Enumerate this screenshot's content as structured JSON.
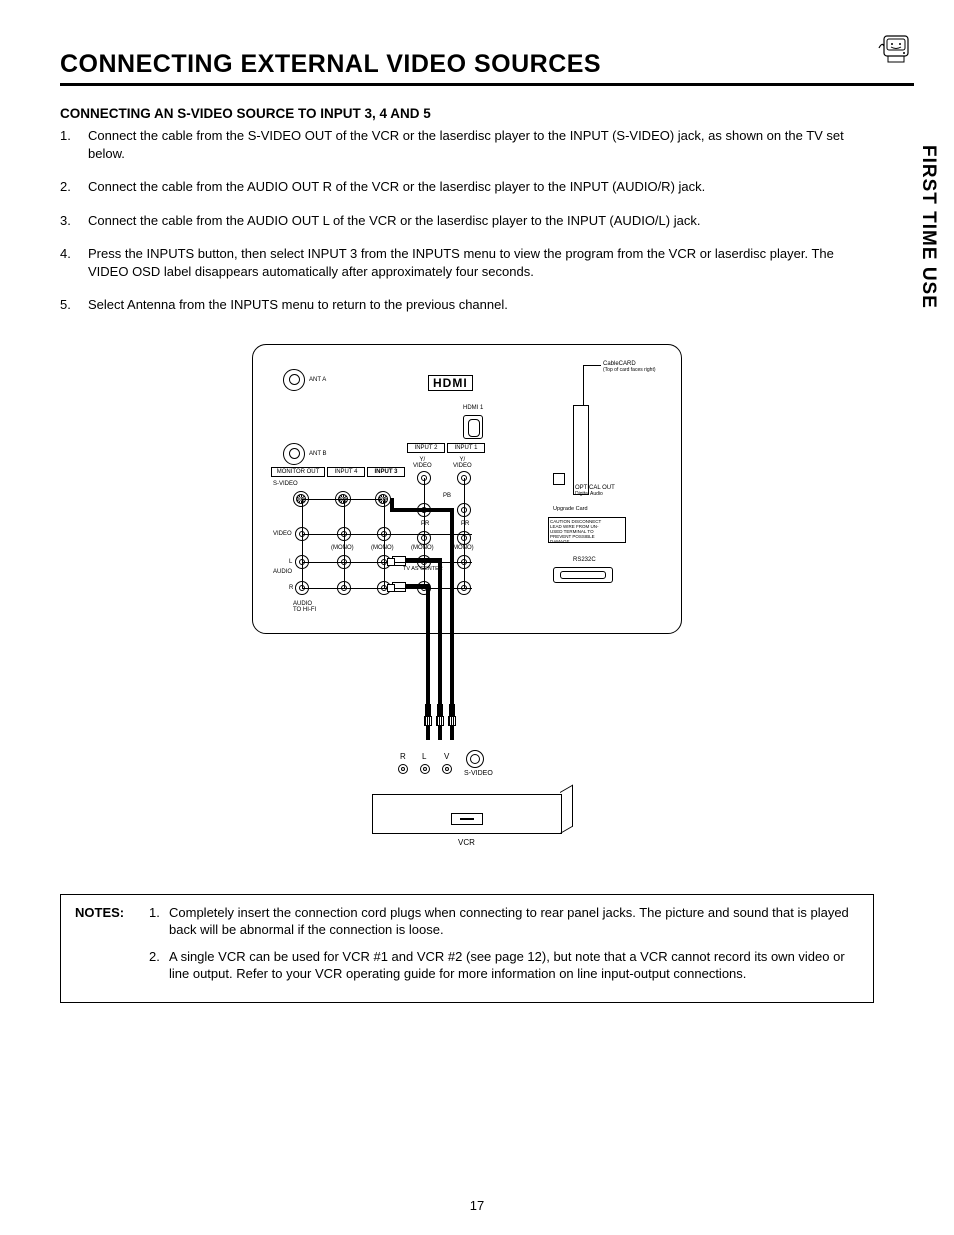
{
  "title": "CONNECTING EXTERNAL VIDEO SOURCES",
  "side_tab": "FIRST TIME USE",
  "section_heading": "CONNECTING AN S-VIDEO SOURCE TO INPUT 3, 4 AND 5",
  "steps": [
    "Connect the cable from the S-VIDEO OUT of the VCR or the laserdisc player to the INPUT (S-VIDEO) jack, as shown on the TV set below.",
    "Connect the cable from the AUDIO OUT R of the VCR or the laserdisc player to the INPUT (AUDIO/R) jack.",
    "Connect the cable from the AUDIO OUT L of the VCR or the laserdisc player to the INPUT (AUDIO/L) jack.",
    "Press the INPUTS button, then select INPUT 3 from the INPUTS menu to view the program from the VCR or laserdisc player. The VIDEO OSD label disappears automatically after approximately four seconds.",
    "Select Antenna from the INPUTS menu to return to the previous channel."
  ],
  "diagram": {
    "hdmi_logo": "HDMI",
    "hdmi1_label": "HDMI 1",
    "ant_a": "ANT A",
    "ant_b": "ANT B",
    "cablecard": "CableCARD",
    "cablecard_note": "(Top of card faces right)",
    "monitor_out": "MONITOR OUT",
    "input4": "INPUT 4",
    "input3": "INPUT 3",
    "input2": "INPUT 2",
    "input1": "INPUT 1",
    "svideo": "S-VIDEO",
    "y_video": "Y/\nVIDEO",
    "pb": "PB",
    "pr": "PR",
    "video": "VIDEO",
    "mono": "(MONO)",
    "audio": "AUDIO",
    "l": "L",
    "r": "R",
    "tv_as_center": "TV AS CENTER",
    "to_hifi": "AUDIO\nTO HI-FI",
    "rs232c": "RS232C",
    "optical_out": "OPTICAL OUT",
    "digital_audio": "Digital Audio",
    "upgrade_card": "Upgrade Card",
    "caution": "CAUTION DISCONNECT\nLEAD WIRE FROM UN-\nUSED TERMINAL TO\nPREVENT POSSIBLE\nDAMAGE.",
    "dev_r": "R",
    "dev_l": "L",
    "dev_v": "V",
    "dev_svideo": "S-VIDEO",
    "vcr": "VCR"
  },
  "notes_label": "NOTES:",
  "notes": [
    "Completely insert the connection cord plugs when connecting to rear panel jacks.  The picture and sound that is played back will be abnormal if the connection is loose.",
    "A single VCR can be used for VCR #1 and VCR #2 (see page 12), but note that a VCR cannot record its own video or line output.  Refer to your VCR operating guide for more information on line input-output connections."
  ],
  "page_number": "17"
}
